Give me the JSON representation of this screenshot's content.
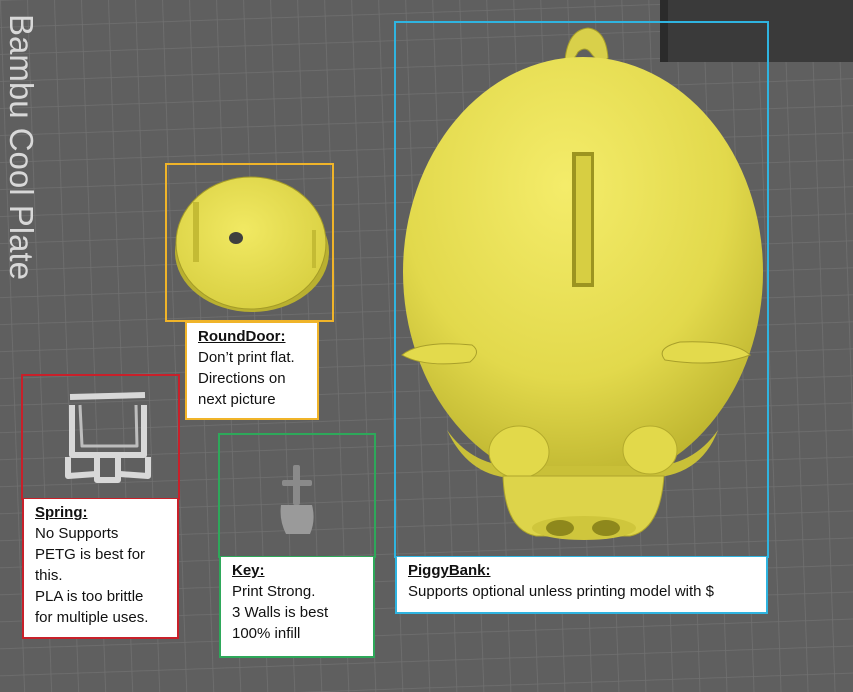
{
  "plate": {
    "label": "Bambu Cool Plate",
    "background": "#5f5f5f",
    "grid_color": "#6e6e6e",
    "label_color": "#d6d6d6"
  },
  "colors": {
    "part": "#e8e057",
    "part_shadow": "#9a9420",
    "round_door_frame": "#f0b429",
    "spring_frame": "#c8202a",
    "key_frame": "#2ea85a",
    "piggy_frame": "#2fb4e0"
  },
  "callouts": {
    "round_door": {
      "title": "RoundDoor:",
      "lines": [
        "Don’t print flat.",
        "Directions on",
        "next picture"
      ]
    },
    "spring": {
      "title": "Spring:",
      "lines": [
        "No Supports",
        "PETG is best for",
        "this.",
        "PLA is too brittle",
        "for multiple uses."
      ]
    },
    "key": {
      "title": "Key:",
      "lines": [
        "Print Strong.",
        "3 Walls is best",
        "100% infill"
      ]
    },
    "piggy_bank": {
      "title": "PiggyBank:",
      "lines": [
        "Supports optional unless printing model with $"
      ]
    }
  }
}
